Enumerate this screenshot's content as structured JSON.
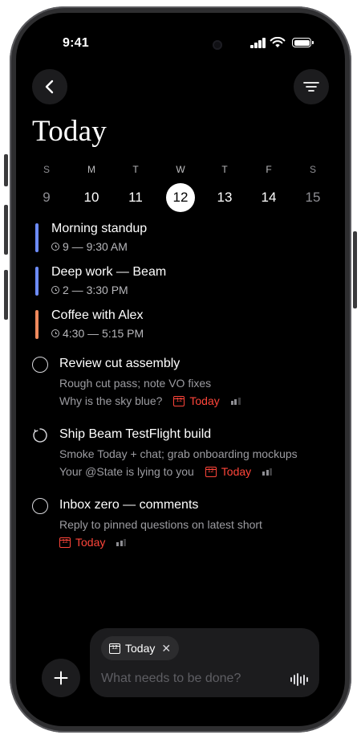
{
  "status_bar": {
    "time": "9:41"
  },
  "header": {
    "title": "Today"
  },
  "week": [
    {
      "dow": "S",
      "num": "9",
      "state": "muted"
    },
    {
      "dow": "M",
      "num": "10",
      "state": "normal"
    },
    {
      "dow": "T",
      "num": "11",
      "state": "normal"
    },
    {
      "dow": "W",
      "num": "12",
      "state": "selected"
    },
    {
      "dow": "T",
      "num": "13",
      "state": "normal"
    },
    {
      "dow": "F",
      "num": "14",
      "state": "normal"
    },
    {
      "dow": "S",
      "num": "15",
      "state": "muted"
    }
  ],
  "events": [
    {
      "title": "Morning standup",
      "time": "9 — 9:30 AM",
      "color": "#6d8cff"
    },
    {
      "title": "Deep work — Beam",
      "time": "2 — 3:30 PM",
      "color": "#6d8cff"
    },
    {
      "title": "Coffee with Alex",
      "time": "4:30 — 5:15 PM",
      "color": "#f08a5d"
    }
  ],
  "tasks": [
    {
      "title": "Review cut assembly",
      "note": "Rough cut pass; note VO fixes",
      "meta_text": "Why is the sky blue?",
      "due": "Today",
      "calendar_day": "12",
      "icon": "circle-outline"
    },
    {
      "title": "Ship Beam TestFlight build",
      "note": "Smoke Today + chat; grab onboarding mockups",
      "meta_text": "Your @State is lying to you",
      "due": "Today",
      "calendar_day": "12",
      "icon": "repeat-circle"
    },
    {
      "title": "Inbox zero — comments",
      "note": "Reply to pinned questions on latest short",
      "meta_text": "",
      "due": "Today",
      "calendar_day": "12",
      "icon": "circle-outline"
    }
  ],
  "composer": {
    "chip_label": "Today",
    "chip_calendar_day": "12",
    "placeholder": "What needs to be done?"
  },
  "colors": {
    "accent_red": "#ff453a",
    "background": "#000000"
  }
}
